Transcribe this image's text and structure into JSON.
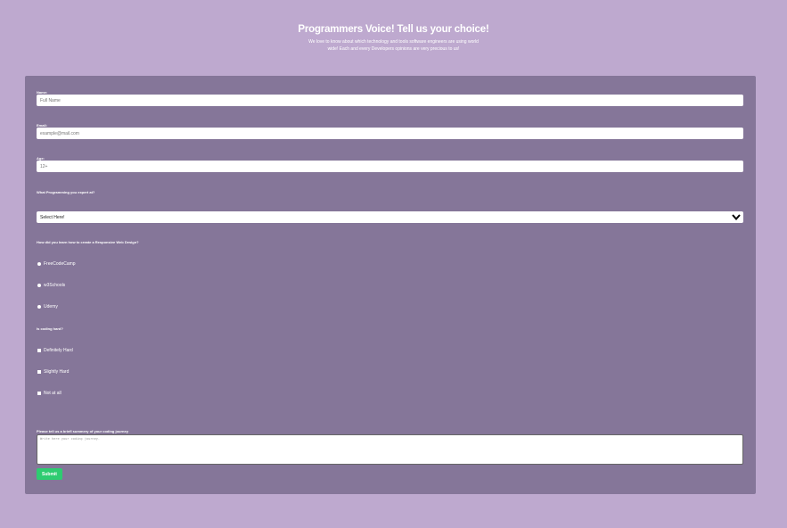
{
  "header": {
    "title": "Programmers Voice! Tell us your choice!",
    "subtitle_line1": "We love to know about which technology and tools software engineers are using world",
    "subtitle_line2": "wide! Each and every Developers opinions are very precious to us!"
  },
  "form": {
    "name_label": "Name:",
    "name_placeholder": "Full Name",
    "email_label": "Email:",
    "email_placeholder": "example@mail.com",
    "age_label": "Age:",
    "age_placeholder": "12+",
    "language_label": "What Programming you expert at?",
    "language_selected": "Select Here!",
    "learn_label": "How did you learn how to create a Responsive Web Design?",
    "learn_options": [
      "FreeCodeCamp",
      "w3Schools",
      "Udemy"
    ],
    "hard_label": "Is coding hard?",
    "hard_options": [
      "Definitely Hard",
      "Slightly Hard",
      "Not at all"
    ],
    "summary_label": "Please tell us a briefl summery of your coding journey",
    "summary_placeholder": "Write here your coding journey.",
    "submit_label": "Submit"
  },
  "colors": {
    "background": "#bea9cf",
    "card": "#857699",
    "submit": "#2ecc71"
  }
}
